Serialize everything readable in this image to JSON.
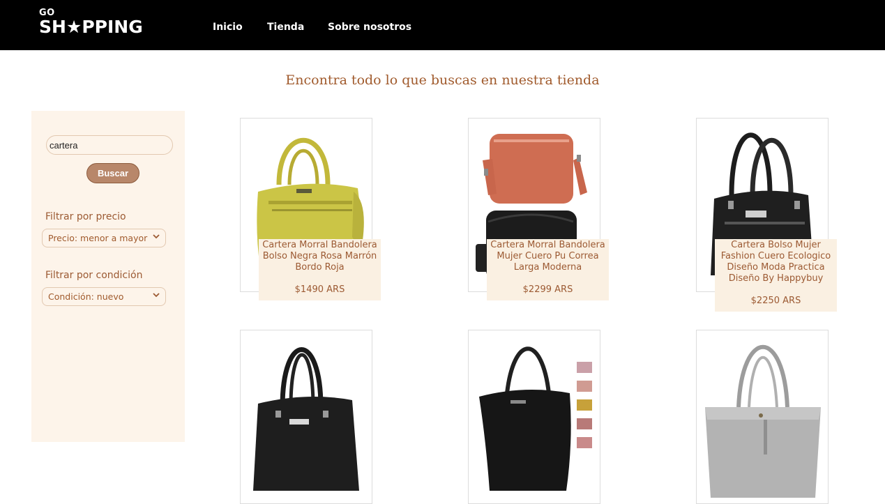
{
  "header": {
    "logo_top": "GO",
    "logo_main": "SH★PPING",
    "nav": [
      "Inicio",
      "Tienda",
      "Sobre nosotros"
    ]
  },
  "title": "Encontra todo lo que buscas en nuestra tienda",
  "sidebar": {
    "search_value": "cartera",
    "search_button": "Buscar",
    "price_filter_label": "Filtrar por precio",
    "price_filter_value": "Precio: menor a mayor",
    "condition_filter_label": "Filtrar por condición",
    "condition_filter_value": "Condición: nuevo"
  },
  "products": [
    {
      "name": "Cartera Morral Bandolera Bolso Negra Rosa Marrón Bordo Roja",
      "price": "$1490 ARS",
      "image": "yellow-handbag"
    },
    {
      "name": "Cartera Morral Bandolera Mujer Cuero Pu Correa Larga Moderna",
      "price": "$2299 ARS",
      "image": "crossbody-bags"
    },
    {
      "name": "Cartera Bolso Mujer Fashion Cuero Ecologico Diseño Moda Practica Diseño By Happybuy",
      "price": "$2250 ARS",
      "image": "black-handbag"
    },
    {
      "name": "",
      "price": "",
      "image": "black-handbag"
    },
    {
      "name": "",
      "price": "",
      "image": "black-shoulder-bag"
    },
    {
      "name": "",
      "price": "",
      "image": "silver-tote"
    }
  ],
  "colors": {
    "header_bg": "#000000",
    "accent": "#a05a2c",
    "sidebar_bg": "#fdf4ea",
    "button_bg": "#b8876a"
  }
}
